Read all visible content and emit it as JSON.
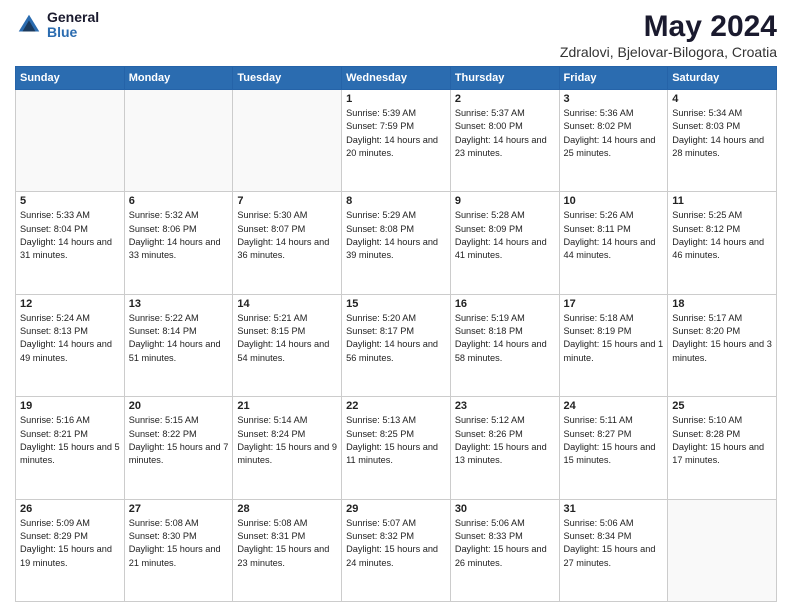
{
  "header": {
    "logo_general": "General",
    "logo_blue": "Blue",
    "title": "May 2024",
    "subtitle": "Zdralovi, Bjelovar-Bilogora, Croatia"
  },
  "columns": [
    "Sunday",
    "Monday",
    "Tuesday",
    "Wednesday",
    "Thursday",
    "Friday",
    "Saturday"
  ],
  "weeks": [
    [
      {
        "day": "",
        "sunrise": "",
        "sunset": "",
        "daylight": ""
      },
      {
        "day": "",
        "sunrise": "",
        "sunset": "",
        "daylight": ""
      },
      {
        "day": "",
        "sunrise": "",
        "sunset": "",
        "daylight": ""
      },
      {
        "day": "1",
        "sunrise": "Sunrise: 5:39 AM",
        "sunset": "Sunset: 7:59 PM",
        "daylight": "Daylight: 14 hours and 20 minutes."
      },
      {
        "day": "2",
        "sunrise": "Sunrise: 5:37 AM",
        "sunset": "Sunset: 8:00 PM",
        "daylight": "Daylight: 14 hours and 23 minutes."
      },
      {
        "day": "3",
        "sunrise": "Sunrise: 5:36 AM",
        "sunset": "Sunset: 8:02 PM",
        "daylight": "Daylight: 14 hours and 25 minutes."
      },
      {
        "day": "4",
        "sunrise": "Sunrise: 5:34 AM",
        "sunset": "Sunset: 8:03 PM",
        "daylight": "Daylight: 14 hours and 28 minutes."
      }
    ],
    [
      {
        "day": "5",
        "sunrise": "Sunrise: 5:33 AM",
        "sunset": "Sunset: 8:04 PM",
        "daylight": "Daylight: 14 hours and 31 minutes."
      },
      {
        "day": "6",
        "sunrise": "Sunrise: 5:32 AM",
        "sunset": "Sunset: 8:06 PM",
        "daylight": "Daylight: 14 hours and 33 minutes."
      },
      {
        "day": "7",
        "sunrise": "Sunrise: 5:30 AM",
        "sunset": "Sunset: 8:07 PM",
        "daylight": "Daylight: 14 hours and 36 minutes."
      },
      {
        "day": "8",
        "sunrise": "Sunrise: 5:29 AM",
        "sunset": "Sunset: 8:08 PM",
        "daylight": "Daylight: 14 hours and 39 minutes."
      },
      {
        "day": "9",
        "sunrise": "Sunrise: 5:28 AM",
        "sunset": "Sunset: 8:09 PM",
        "daylight": "Daylight: 14 hours and 41 minutes."
      },
      {
        "day": "10",
        "sunrise": "Sunrise: 5:26 AM",
        "sunset": "Sunset: 8:11 PM",
        "daylight": "Daylight: 14 hours and 44 minutes."
      },
      {
        "day": "11",
        "sunrise": "Sunrise: 5:25 AM",
        "sunset": "Sunset: 8:12 PM",
        "daylight": "Daylight: 14 hours and 46 minutes."
      }
    ],
    [
      {
        "day": "12",
        "sunrise": "Sunrise: 5:24 AM",
        "sunset": "Sunset: 8:13 PM",
        "daylight": "Daylight: 14 hours and 49 minutes."
      },
      {
        "day": "13",
        "sunrise": "Sunrise: 5:22 AM",
        "sunset": "Sunset: 8:14 PM",
        "daylight": "Daylight: 14 hours and 51 minutes."
      },
      {
        "day": "14",
        "sunrise": "Sunrise: 5:21 AM",
        "sunset": "Sunset: 8:15 PM",
        "daylight": "Daylight: 14 hours and 54 minutes."
      },
      {
        "day": "15",
        "sunrise": "Sunrise: 5:20 AM",
        "sunset": "Sunset: 8:17 PM",
        "daylight": "Daylight: 14 hours and 56 minutes."
      },
      {
        "day": "16",
        "sunrise": "Sunrise: 5:19 AM",
        "sunset": "Sunset: 8:18 PM",
        "daylight": "Daylight: 14 hours and 58 minutes."
      },
      {
        "day": "17",
        "sunrise": "Sunrise: 5:18 AM",
        "sunset": "Sunset: 8:19 PM",
        "daylight": "Daylight: 15 hours and 1 minute."
      },
      {
        "day": "18",
        "sunrise": "Sunrise: 5:17 AM",
        "sunset": "Sunset: 8:20 PM",
        "daylight": "Daylight: 15 hours and 3 minutes."
      }
    ],
    [
      {
        "day": "19",
        "sunrise": "Sunrise: 5:16 AM",
        "sunset": "Sunset: 8:21 PM",
        "daylight": "Daylight: 15 hours and 5 minutes."
      },
      {
        "day": "20",
        "sunrise": "Sunrise: 5:15 AM",
        "sunset": "Sunset: 8:22 PM",
        "daylight": "Daylight: 15 hours and 7 minutes."
      },
      {
        "day": "21",
        "sunrise": "Sunrise: 5:14 AM",
        "sunset": "Sunset: 8:24 PM",
        "daylight": "Daylight: 15 hours and 9 minutes."
      },
      {
        "day": "22",
        "sunrise": "Sunrise: 5:13 AM",
        "sunset": "Sunset: 8:25 PM",
        "daylight": "Daylight: 15 hours and 11 minutes."
      },
      {
        "day": "23",
        "sunrise": "Sunrise: 5:12 AM",
        "sunset": "Sunset: 8:26 PM",
        "daylight": "Daylight: 15 hours and 13 minutes."
      },
      {
        "day": "24",
        "sunrise": "Sunrise: 5:11 AM",
        "sunset": "Sunset: 8:27 PM",
        "daylight": "Daylight: 15 hours and 15 minutes."
      },
      {
        "day": "25",
        "sunrise": "Sunrise: 5:10 AM",
        "sunset": "Sunset: 8:28 PM",
        "daylight": "Daylight: 15 hours and 17 minutes."
      }
    ],
    [
      {
        "day": "26",
        "sunrise": "Sunrise: 5:09 AM",
        "sunset": "Sunset: 8:29 PM",
        "daylight": "Daylight: 15 hours and 19 minutes."
      },
      {
        "day": "27",
        "sunrise": "Sunrise: 5:08 AM",
        "sunset": "Sunset: 8:30 PM",
        "daylight": "Daylight: 15 hours and 21 minutes."
      },
      {
        "day": "28",
        "sunrise": "Sunrise: 5:08 AM",
        "sunset": "Sunset: 8:31 PM",
        "daylight": "Daylight: 15 hours and 23 minutes."
      },
      {
        "day": "29",
        "sunrise": "Sunrise: 5:07 AM",
        "sunset": "Sunset: 8:32 PM",
        "daylight": "Daylight: 15 hours and 24 minutes."
      },
      {
        "day": "30",
        "sunrise": "Sunrise: 5:06 AM",
        "sunset": "Sunset: 8:33 PM",
        "daylight": "Daylight: 15 hours and 26 minutes."
      },
      {
        "day": "31",
        "sunrise": "Sunrise: 5:06 AM",
        "sunset": "Sunset: 8:34 PM",
        "daylight": "Daylight: 15 hours and 27 minutes."
      },
      {
        "day": "",
        "sunrise": "",
        "sunset": "",
        "daylight": ""
      }
    ]
  ]
}
